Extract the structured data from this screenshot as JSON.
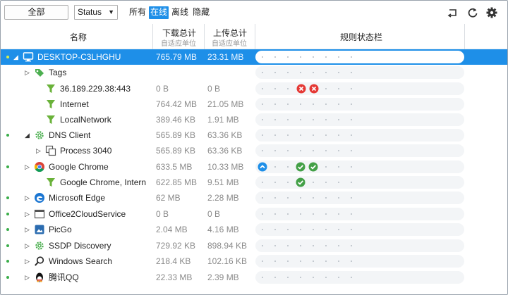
{
  "toolbar": {
    "all_button": "全部",
    "status_select": "Status",
    "filters": [
      "所有",
      "在线",
      "离线",
      "隐藏"
    ],
    "active_filter": "在线",
    "icons": [
      "return-icon",
      "refresh-icon",
      "gear-icon"
    ]
  },
  "columns": {
    "name": "名称",
    "download": "下载总计",
    "download_sub": "自适应单位",
    "upload": "上传总计",
    "upload_sub": "自适应单位",
    "rules": "规则状态栏"
  },
  "colors": {
    "accent": "#1e8fe8",
    "online_dot": "#3aae4a",
    "block": "#e53935",
    "allow": "#43a047"
  },
  "rows": [
    {
      "name": "DESKTOP-C3LHGHU",
      "down": "765.79 MB",
      "up": "23.31 MB",
      "icon": "monitor-icon",
      "selected": true,
      "dot": true,
      "expander": "expanded"
    },
    {
      "name": "Tags",
      "down": "",
      "up": "",
      "icon": "tags-icon",
      "dot": false,
      "expander": "collapsed"
    },
    {
      "name": "36.189.229.38:443",
      "down": "0 B",
      "up": "0 B",
      "icon": "filter-icon",
      "dot": false,
      "badges": [
        "block",
        "block"
      ]
    },
    {
      "name": "Internet",
      "down": "764.42 MB",
      "up": "21.05 MB",
      "icon": "filter-icon",
      "dot": false
    },
    {
      "name": "LocalNetwork",
      "down": "389.46 KB",
      "up": "1.91 MB",
      "icon": "filter-icon",
      "dot": false
    },
    {
      "name": "DNS Client",
      "down": "565.89 KB",
      "up": "63.36 KB",
      "icon": "gear-app-icon",
      "dot": true,
      "expander": "expanded"
    },
    {
      "name": "Process 3040",
      "down": "565.89 KB",
      "up": "63.36 KB",
      "icon": "process-icon",
      "dot": false,
      "expander": "collapsed"
    },
    {
      "name": "Google Chrome",
      "down": "633.5 MB",
      "up": "10.33 MB",
      "icon": "chrome-icon",
      "dot": true,
      "expander": "collapsed",
      "badges": [
        "info",
        "allow",
        "allow"
      ]
    },
    {
      "name": "Google Chrome, Intern",
      "down": "622.85 MB",
      "up": "9.51 MB",
      "icon": "filter-icon",
      "dot": false,
      "badges": [
        "allow"
      ]
    },
    {
      "name": "Microsoft Edge",
      "down": "62 MB",
      "up": "2.28 MB",
      "icon": "edge-icon",
      "dot": true,
      "expander": "collapsed"
    },
    {
      "name": "Office2CloudService",
      "down": "0 B",
      "up": "0 B",
      "icon": "window-icon",
      "dot": true,
      "expander": "collapsed"
    },
    {
      "name": "PicGo",
      "down": "2.04 MB",
      "up": "4.16 MB",
      "icon": "picgo-icon",
      "dot": true,
      "expander": "collapsed"
    },
    {
      "name": "SSDP Discovery",
      "down": "729.92 KB",
      "up": "898.94 KB",
      "icon": "gear-app-icon",
      "dot": true,
      "expander": "collapsed"
    },
    {
      "name": "Windows Search",
      "down": "218.4 KB",
      "up": "102.16 KB",
      "icon": "search-icon",
      "dot": true,
      "expander": "collapsed"
    },
    {
      "name": "腾讯QQ",
      "down": "22.33 MB",
      "up": "2.39 MB",
      "icon": "qq-icon",
      "dot": true,
      "expander": "collapsed"
    }
  ]
}
